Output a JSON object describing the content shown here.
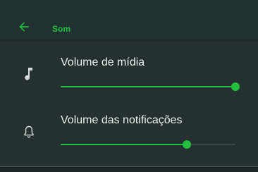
{
  "header": {
    "title": "Som",
    "back_icon": "arrow-left-icon"
  },
  "settings": [
    {
      "label": "Volume de mídia",
      "icon": "music-note-icon",
      "value": 1.0
    },
    {
      "label": "Volume das notificações",
      "icon": "bell-icon",
      "value": 0.72
    }
  ],
  "colors": {
    "accent": "#22c03c",
    "background": "#253030",
    "header_background": "#203131",
    "text": "#ecf0ef",
    "track": "#394848"
  }
}
